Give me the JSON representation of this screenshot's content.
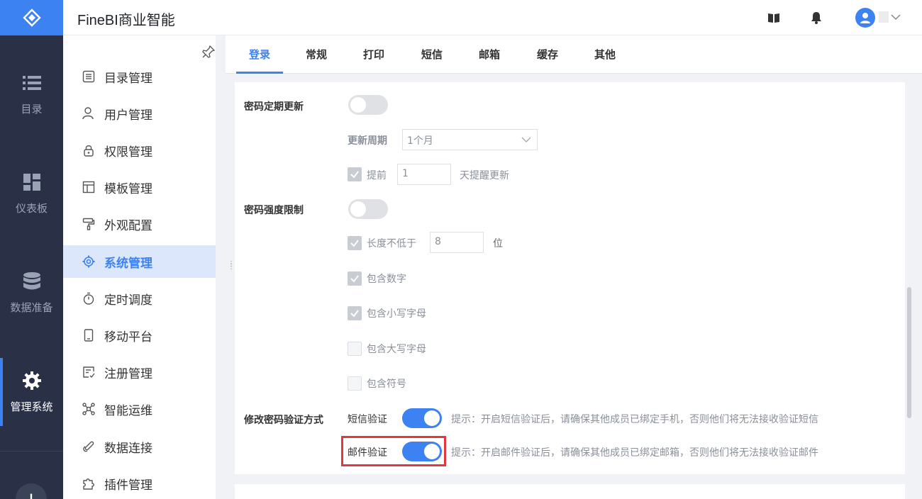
{
  "app": {
    "title": "FineBI商业智能"
  },
  "rail": {
    "items": [
      {
        "label": "目录",
        "icon": "list-icon"
      },
      {
        "label": "仪表板",
        "icon": "dashboard-icon"
      },
      {
        "label": "数据准备",
        "icon": "database-icon"
      },
      {
        "label": "管理系统",
        "icon": "gear-icon",
        "active": true
      }
    ],
    "add_label": "+"
  },
  "sidebar": {
    "items": [
      {
        "label": "目录管理",
        "icon": "directory-icon"
      },
      {
        "label": "用户管理",
        "icon": "user-icon"
      },
      {
        "label": "权限管理",
        "icon": "lock-icon"
      },
      {
        "label": "模板管理",
        "icon": "template-icon"
      },
      {
        "label": "外观配置",
        "icon": "paint-roller-icon"
      },
      {
        "label": "系统管理",
        "icon": "gear-icon",
        "active": true
      },
      {
        "label": "定时调度",
        "icon": "stopwatch-icon"
      },
      {
        "label": "移动平台",
        "icon": "mobile-icon"
      },
      {
        "label": "注册管理",
        "icon": "register-icon"
      },
      {
        "label": "智能运维",
        "icon": "ops-icon"
      },
      {
        "label": "数据连接",
        "icon": "link-icon"
      },
      {
        "label": "插件管理",
        "icon": "puzzle-icon"
      }
    ]
  },
  "tabs": [
    {
      "label": "登录",
      "active": true
    },
    {
      "label": "常规"
    },
    {
      "label": "打印"
    },
    {
      "label": "短信"
    },
    {
      "label": "邮箱"
    },
    {
      "label": "缓存"
    },
    {
      "label": "其他"
    }
  ],
  "settings": {
    "pwd_update": {
      "label": "密码定期更新",
      "enabled": false,
      "period_label": "更新周期",
      "period_value": "1个月",
      "remind_prefix": "提前",
      "remind_days": "1",
      "remind_suffix": "天提醒更新"
    },
    "pwd_strength": {
      "label": "密码强度限制",
      "enabled": false,
      "min_length_prefix": "长度不低于",
      "min_length": "8",
      "min_length_suffix": "位",
      "rules": [
        {
          "label": "包含数字",
          "checked": true
        },
        {
          "label": "包含小写字母",
          "checked": true
        },
        {
          "label": "包含大写字母",
          "checked": false
        },
        {
          "label": "包含符号",
          "checked": false
        }
      ]
    },
    "verify": {
      "label": "修改密码验证方式",
      "sms_label": "短信验证",
      "sms_enabled": true,
      "sms_hint": "提示：开启短信验证后，请确保其他成员已绑定手机，否则他们将无法接收验证短信",
      "email_label": "邮件验证",
      "email_enabled": true,
      "email_hint": "提示：开启邮件验证后，请确保其他成员已绑定邮箱，否则他们将无法接收验证邮件"
    }
  },
  "colors": {
    "accent": "#3d82f2",
    "rail_bg": "#2a3147",
    "highlight": "#e0383e"
  }
}
